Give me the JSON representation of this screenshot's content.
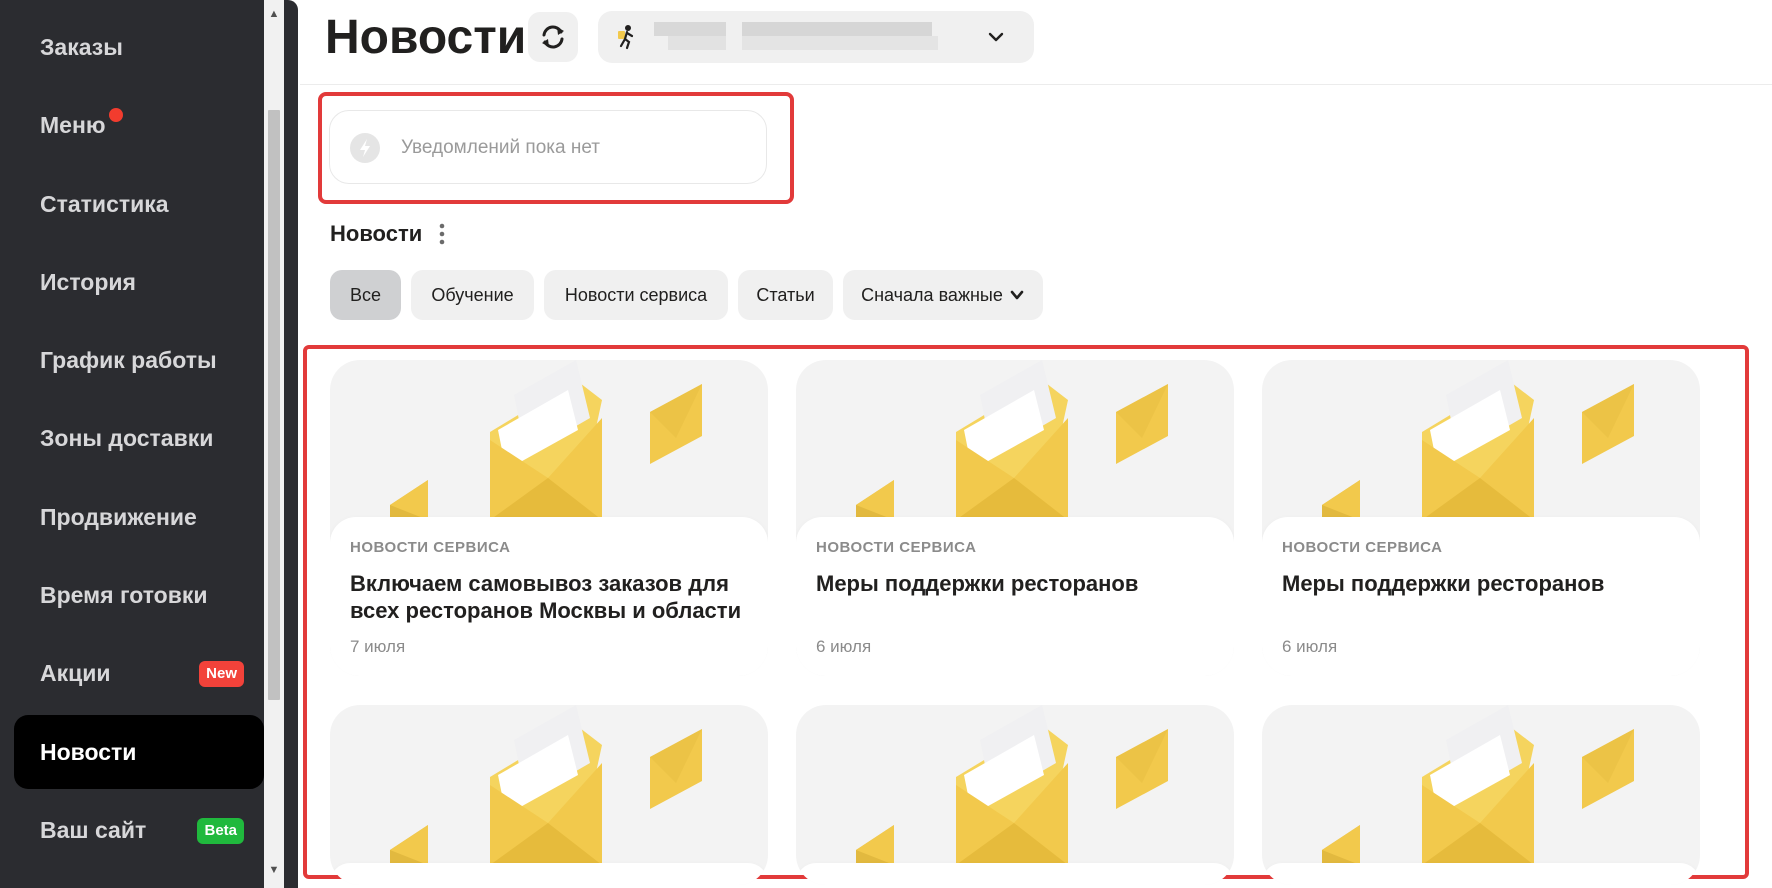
{
  "sidebar": {
    "items": [
      {
        "label": "Заказы"
      },
      {
        "label": "Меню"
      },
      {
        "label": "Статистика"
      },
      {
        "label": "История"
      },
      {
        "label": "График работы"
      },
      {
        "label": "Зоны доставки"
      },
      {
        "label": "Продвижение"
      },
      {
        "label": "Время готовки"
      },
      {
        "label": "Акции",
        "badge": "New"
      },
      {
        "label": "Новости"
      },
      {
        "label": "Ваш сайт",
        "badge": "Beta"
      }
    ],
    "active": "Новости"
  },
  "header": {
    "title": "Новости",
    "refresh_icon": "refresh-icon",
    "restaurant_select_icon": "courier-icon"
  },
  "notifications": {
    "empty_text": "Уведомлений пока нет",
    "icon": "lightning-icon"
  },
  "news": {
    "title": "Новости",
    "filters": [
      "Все",
      "Обучение",
      "Новости сервиса",
      "Статьи"
    ],
    "sort_label": "Сначала важные",
    "selected_filter": "Все",
    "cards": [
      {
        "category": "НОВОСТИ СЕРВИСА",
        "title": "Включаем самовывоз заказов для всех ресторанов Москвы и области",
        "date": "7 июля"
      },
      {
        "category": "НОВОСТИ СЕРВИСА",
        "title": "Меры поддержки ресторанов",
        "date": "6 июля"
      },
      {
        "category": "НОВОСТИ СЕРВИСА",
        "title": "Меры поддержки ресторанов",
        "date": "6 июля"
      }
    ]
  },
  "colors": {
    "sidebar_bg": "#2b2c30",
    "accent_red": "#e23a3a",
    "badge_new": "#f2423a",
    "badge_beta": "#20b93d",
    "envelope_yellow": "#f2c94c"
  }
}
